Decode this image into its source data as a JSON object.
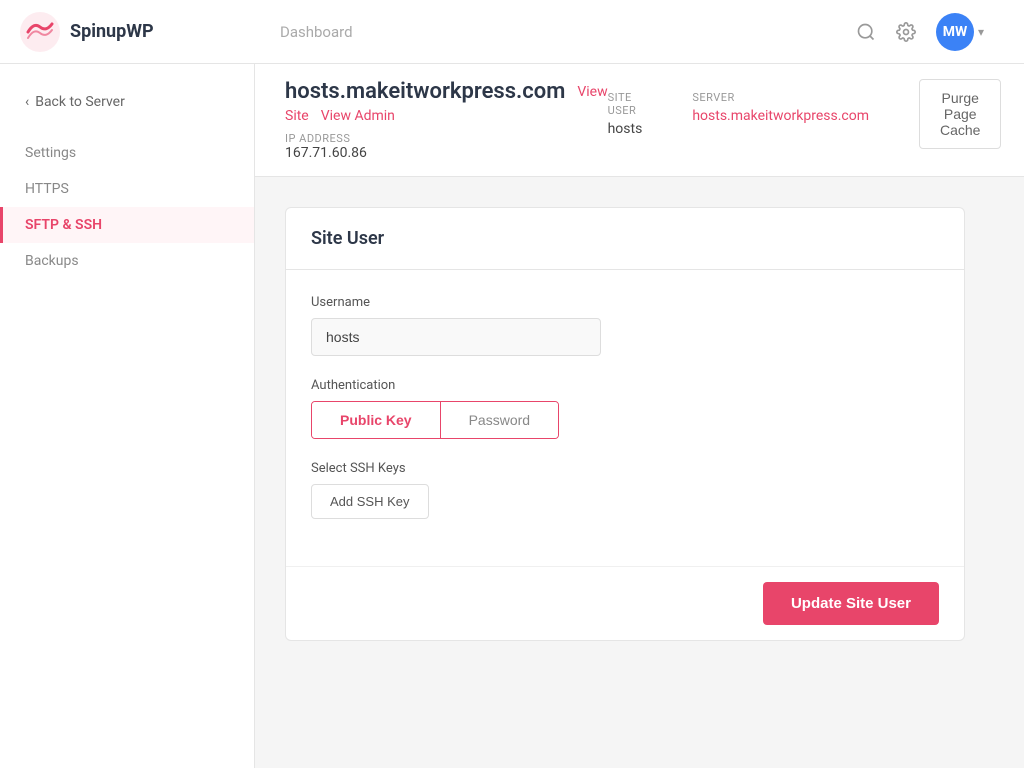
{
  "app": {
    "logo_text": "SpinupWP",
    "nav_dashboard": "Dashboard"
  },
  "topnav": {
    "search_placeholder": "Dashboard",
    "search_icon": "search-icon",
    "settings_icon": "gear-icon",
    "avatar_initials": "MW",
    "avatar_chevron": "▾"
  },
  "sidebar": {
    "back_label": "Back to Server",
    "items": [
      {
        "id": "settings",
        "label": "Settings",
        "active": false
      },
      {
        "id": "https",
        "label": "HTTPS",
        "active": false
      },
      {
        "id": "sftp-ssh",
        "label": "SFTP & SSH",
        "active": true
      },
      {
        "id": "backups",
        "label": "Backups",
        "active": false
      }
    ]
  },
  "site_header": {
    "title": "hosts.makeitworkpress.com",
    "view_link": "View",
    "site_link": "Site",
    "admin_link": "View Admin",
    "ip_label": "IP ADDRESS",
    "ip_value": "167.71.60.86",
    "purge_btn": "Purge Page Cache",
    "meta": {
      "site_user_label": "SITE USER",
      "site_user_value": "hosts",
      "server_label": "SERVER",
      "server_value": "hosts.makeitworkpress.com"
    }
  },
  "card": {
    "title": "Site User",
    "username_label": "Username",
    "username_value": "hosts",
    "auth_label": "Authentication",
    "auth_options": [
      {
        "id": "public-key",
        "label": "Public Key",
        "active": true
      },
      {
        "id": "password",
        "label": "Password",
        "active": false
      }
    ],
    "ssh_keys_label": "Select SSH Keys",
    "add_ssh_btn": "Add SSH Key",
    "update_btn": "Update Site User"
  }
}
